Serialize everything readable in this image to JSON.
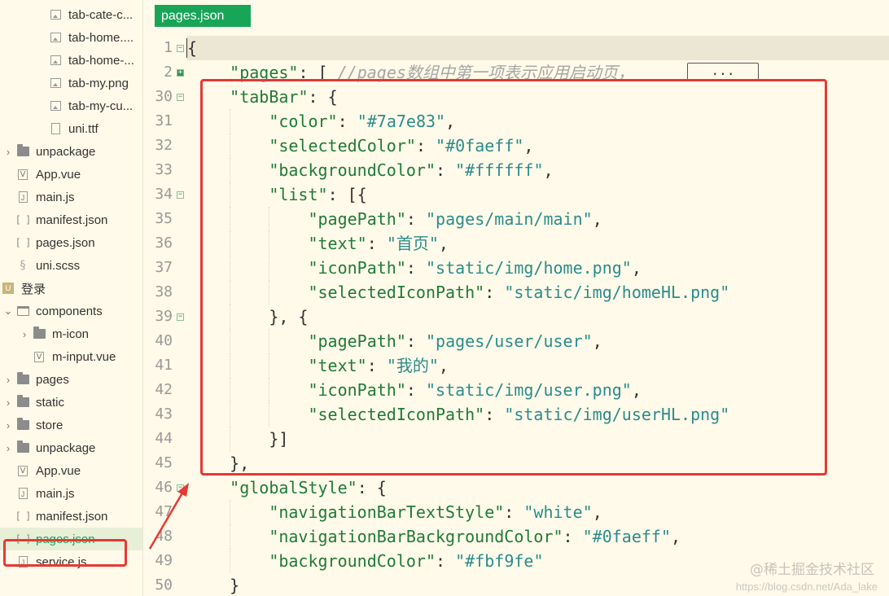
{
  "sidebar": {
    "items": [
      {
        "label": "tab-cate-c...",
        "type": "image",
        "indent": 2,
        "arrow": ""
      },
      {
        "label": "tab-home....",
        "type": "image",
        "indent": 2,
        "arrow": ""
      },
      {
        "label": "tab-home-...",
        "type": "image",
        "indent": 2,
        "arrow": ""
      },
      {
        "label": "tab-my.png",
        "type": "image",
        "indent": 2,
        "arrow": ""
      },
      {
        "label": "tab-my-cu...",
        "type": "image",
        "indent": 2,
        "arrow": ""
      },
      {
        "label": "uni.ttf",
        "type": "file",
        "indent": 2,
        "arrow": ""
      },
      {
        "label": "unpackage",
        "type": "folder",
        "indent": 0,
        "arrow": "›"
      },
      {
        "label": "App.vue",
        "type": "vue",
        "indent": 0,
        "arrow": ""
      },
      {
        "label": "main.js",
        "type": "js",
        "indent": 0,
        "arrow": ""
      },
      {
        "label": "manifest.json",
        "type": "json",
        "indent": 0,
        "arrow": ""
      },
      {
        "label": "pages.json",
        "type": "json",
        "indent": 0,
        "arrow": ""
      },
      {
        "label": "uni.scss",
        "type": "scss",
        "indent": 0,
        "arrow": ""
      },
      {
        "label": "登录",
        "type": "project",
        "indent": -1,
        "arrow": ""
      },
      {
        "label": "components",
        "type": "folder-open",
        "indent": 0,
        "arrow": "⌄"
      },
      {
        "label": "m-icon",
        "type": "folder",
        "indent": 1,
        "arrow": "›"
      },
      {
        "label": "m-input.vue",
        "type": "vue",
        "indent": 1,
        "arrow": ""
      },
      {
        "label": "pages",
        "type": "folder",
        "indent": 0,
        "arrow": "›"
      },
      {
        "label": "static",
        "type": "folder",
        "indent": 0,
        "arrow": "›"
      },
      {
        "label": "store",
        "type": "folder",
        "indent": 0,
        "arrow": "›"
      },
      {
        "label": "unpackage",
        "type": "folder",
        "indent": 0,
        "arrow": "›"
      },
      {
        "label": "App.vue",
        "type": "vue",
        "indent": 0,
        "arrow": ""
      },
      {
        "label": "main.js",
        "type": "js",
        "indent": 0,
        "arrow": ""
      },
      {
        "label": "manifest.json",
        "type": "json",
        "indent": 0,
        "arrow": ""
      },
      {
        "label": "pages.json",
        "type": "json",
        "indent": 0,
        "arrow": "",
        "selected": true
      },
      {
        "label": "service.js",
        "type": "js",
        "indent": 0,
        "arrow": ""
      }
    ]
  },
  "editor": {
    "tab_label": "pages.json",
    "fold_placeholder": "...",
    "lines": [
      {
        "num": "1",
        "fold": "open",
        "indent": 0,
        "tokens": [
          [
            "p",
            "{"
          ]
        ],
        "current": true
      },
      {
        "num": "2",
        "fold": "collapsed",
        "indent": 1,
        "tokens": [
          [
            "k",
            "\"pages\""
          ],
          [
            "p",
            ": [ "
          ],
          [
            "cm",
            "//pages数组中第一项表示应用启动页，"
          ]
        ]
      },
      {
        "num": "30",
        "fold": "open",
        "indent": 1,
        "tokens": [
          [
            "k",
            "\"tabBar\""
          ],
          [
            "p",
            ": {"
          ]
        ]
      },
      {
        "num": "31",
        "fold": "",
        "indent": 2,
        "tokens": [
          [
            "k",
            "\"color\""
          ],
          [
            "p",
            ": "
          ],
          [
            "s",
            "\"#7a7e83\""
          ],
          [
            "p",
            ","
          ]
        ]
      },
      {
        "num": "32",
        "fold": "",
        "indent": 2,
        "tokens": [
          [
            "k",
            "\"selectedColor\""
          ],
          [
            "p",
            ": "
          ],
          [
            "s",
            "\"#0faeff\""
          ],
          [
            "p",
            ","
          ]
        ]
      },
      {
        "num": "33",
        "fold": "",
        "indent": 2,
        "tokens": [
          [
            "k",
            "\"backgroundColor\""
          ],
          [
            "p",
            ": "
          ],
          [
            "s",
            "\"#ffffff\""
          ],
          [
            "p",
            ","
          ]
        ]
      },
      {
        "num": "34",
        "fold": "open",
        "indent": 2,
        "tokens": [
          [
            "k",
            "\"list\""
          ],
          [
            "p",
            ": [{"
          ]
        ]
      },
      {
        "num": "35",
        "fold": "",
        "indent": 3,
        "tokens": [
          [
            "k",
            "\"pagePath\""
          ],
          [
            "p",
            ": "
          ],
          [
            "s",
            "\"pages/main/main\""
          ],
          [
            "p",
            ","
          ]
        ]
      },
      {
        "num": "36",
        "fold": "",
        "indent": 3,
        "tokens": [
          [
            "k",
            "\"text\""
          ],
          [
            "p",
            ": "
          ],
          [
            "s",
            "\"首页\""
          ],
          [
            "p",
            ","
          ]
        ]
      },
      {
        "num": "37",
        "fold": "",
        "indent": 3,
        "tokens": [
          [
            "k",
            "\"iconPath\""
          ],
          [
            "p",
            ": "
          ],
          [
            "s",
            "\"static/img/home.png\""
          ],
          [
            "p",
            ","
          ]
        ]
      },
      {
        "num": "38",
        "fold": "",
        "indent": 3,
        "tokens": [
          [
            "k",
            "\"selectedIconPath\""
          ],
          [
            "p",
            ": "
          ],
          [
            "s",
            "\"static/img/homeHL.png\""
          ]
        ]
      },
      {
        "num": "39",
        "fold": "open",
        "indent": 2,
        "tokens": [
          [
            "p",
            "}, {"
          ]
        ]
      },
      {
        "num": "40",
        "fold": "",
        "indent": 3,
        "tokens": [
          [
            "k",
            "\"pagePath\""
          ],
          [
            "p",
            ": "
          ],
          [
            "s",
            "\"pages/user/user\""
          ],
          [
            "p",
            ","
          ]
        ]
      },
      {
        "num": "41",
        "fold": "",
        "indent": 3,
        "tokens": [
          [
            "k",
            "\"text\""
          ],
          [
            "p",
            ": "
          ],
          [
            "s",
            "\"我的\""
          ],
          [
            "p",
            ","
          ]
        ]
      },
      {
        "num": "42",
        "fold": "",
        "indent": 3,
        "tokens": [
          [
            "k",
            "\"iconPath\""
          ],
          [
            "p",
            ": "
          ],
          [
            "s",
            "\"static/img/user.png\""
          ],
          [
            "p",
            ","
          ]
        ]
      },
      {
        "num": "43",
        "fold": "",
        "indent": 3,
        "tokens": [
          [
            "k",
            "\"selectedIconPath\""
          ],
          [
            "p",
            ": "
          ],
          [
            "s",
            "\"static/img/userHL.png\""
          ]
        ]
      },
      {
        "num": "44",
        "fold": "",
        "indent": 2,
        "tokens": [
          [
            "p",
            "}]"
          ]
        ]
      },
      {
        "num": "45",
        "fold": "",
        "indent": 1,
        "tokens": [
          [
            "p",
            "},"
          ]
        ]
      },
      {
        "num": "46",
        "fold": "open",
        "indent": 1,
        "tokens": [
          [
            "k",
            "\"globalStyle\""
          ],
          [
            "p",
            ": {"
          ]
        ]
      },
      {
        "num": "47",
        "fold": "",
        "indent": 2,
        "tokens": [
          [
            "k",
            "\"navigationBarTextStyle\""
          ],
          [
            "p",
            ": "
          ],
          [
            "s",
            "\"white\""
          ],
          [
            "p",
            ","
          ]
        ]
      },
      {
        "num": "48",
        "fold": "",
        "indent": 2,
        "tokens": [
          [
            "k",
            "\"navigationBarBackgroundColor\""
          ],
          [
            "p",
            ": "
          ],
          [
            "s",
            "\"#0faeff\""
          ],
          [
            "p",
            ","
          ]
        ]
      },
      {
        "num": "49",
        "fold": "",
        "indent": 2,
        "tokens": [
          [
            "k",
            "\"backgroundColor\""
          ],
          [
            "p",
            ": "
          ],
          [
            "s",
            "\"#fbf9fe\""
          ]
        ]
      },
      {
        "num": "50",
        "fold": "",
        "indent": 1,
        "tokens": [
          [
            "p",
            "}"
          ]
        ]
      }
    ]
  },
  "watermark": {
    "text": "@稀土掘金技术社区",
    "url": "https://blog.csdn.net/Ada_lake"
  },
  "colors": {
    "accent": "#18a558",
    "highlight_box": "#e53935",
    "background": "#fffae9"
  }
}
